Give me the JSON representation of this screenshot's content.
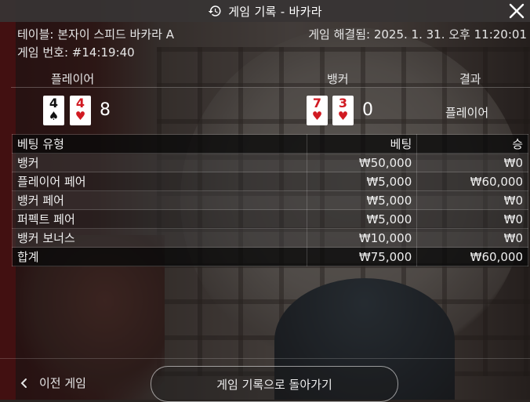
{
  "header": {
    "title": "게임 기록 - 바카라"
  },
  "info": {
    "table_label": "테이블: 본자이 스피드 바카라 A",
    "resolved_label": "게임 해결됨: 2025. 1. 31. 오후 11:20:01",
    "game_number_label": "게임 번호: #14:19:40"
  },
  "cards_panel": {
    "player_header": "플레이어",
    "banker_header": "뱅커",
    "result_header": "결과",
    "player_cards": [
      {
        "rank": "4",
        "suit": "♠",
        "color": "black"
      },
      {
        "rank": "4",
        "suit": "♥",
        "color": "red"
      }
    ],
    "player_score": "8",
    "banker_cards": [
      {
        "rank": "7",
        "suit": "♥",
        "color": "red"
      },
      {
        "rank": "3",
        "suit": "♥",
        "color": "red"
      }
    ],
    "banker_score": "0",
    "result": "플레이어"
  },
  "bets_table": {
    "headers": [
      "베팅 유형",
      "베팅",
      "승"
    ],
    "rows": [
      [
        "뱅커",
        "₩50,000",
        "₩0"
      ],
      [
        "플레이어 페어",
        "₩5,000",
        "₩60,000"
      ],
      [
        "뱅커 페어",
        "₩5,000",
        "₩0"
      ],
      [
        "퍼펙트 페어",
        "₩5,000",
        "₩0"
      ],
      [
        "뱅커 보너스",
        "₩10,000",
        "₩0"
      ]
    ],
    "total": [
      "합계",
      "₩75,000",
      "₩60,000"
    ]
  },
  "footer": {
    "prev_label": "이전 게임",
    "back_label": "게임 기록으로 돌아가기"
  }
}
